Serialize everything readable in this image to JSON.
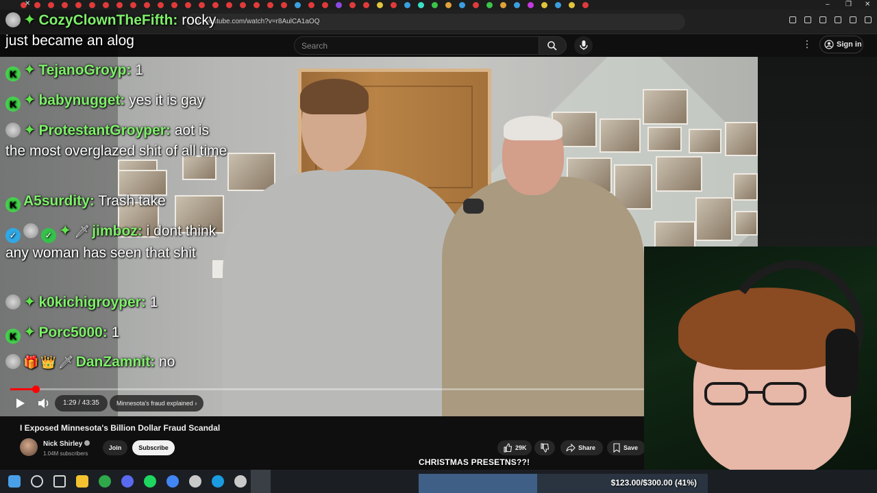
{
  "browser": {
    "url": "youtube.com/watch?v=r8AulCA1aOQ",
    "tab_colors": [
      "#e03a3a",
      "#e03a3a",
      "#e03a3a",
      "#e03a3a",
      "#e03a3a",
      "#e03a3a",
      "#e03a3a",
      "#e03a3a",
      "#e03a3a",
      "#e03a3a",
      "#e03a3a",
      "#e03a3a",
      "#e03a3a",
      "#e03a3a",
      "#e03a3a",
      "#e03a3a",
      "#e03a3a",
      "#e03a3a",
      "#e03a3a",
      "#e03a3a",
      "#3aa0e0",
      "#e03a3a",
      "#e03a3a",
      "#8a4ae0",
      "#e03a3a",
      "#e03a3a",
      "#e0c43a",
      "#e03a3a",
      "#3a9ee0",
      "#3ae0c4",
      "#3ac44a",
      "#e0a03a",
      "#3a9ee0",
      "#e03a3a",
      "#3ac44a",
      "#e0a03a",
      "#3a9ee0",
      "#c43ae0",
      "#e0c43a",
      "#3a9ee0",
      "#e0c43a",
      "#e03a3a"
    ]
  },
  "youtube": {
    "search_placeholder": "Search",
    "signin_label": "Sign in"
  },
  "chat": [
    {
      "badges": [
        "avatar",
        "star"
      ],
      "name": "CozyClownTheFifth:",
      "text": "rocky just became an alog",
      "wrap": true
    },
    {
      "badges": [
        "k",
        "star"
      ],
      "name": "TejanoGroyp:",
      "text": "1"
    },
    {
      "badges": [
        "k",
        "star"
      ],
      "name": "babynugget:",
      "text": "yes it is gay"
    },
    {
      "badges": [
        "avatar",
        "star"
      ],
      "name": "ProtestantGroyper:",
      "text": "aot is the most overglazed shit of all time",
      "wrap": true
    },
    {
      "badges": [
        "k"
      ],
      "name": "A5surdity:",
      "text": "Trash take"
    },
    {
      "badges": [
        "check",
        "avatar",
        "gcheck",
        "star",
        "sword"
      ],
      "name": "jimboz:",
      "text": "i dont think any woman has seen that shit",
      "wrap": true
    },
    {
      "badges": [
        "avatar",
        "star"
      ],
      "name": "k0kichigroyper:",
      "text": "1"
    },
    {
      "badges": [
        "k",
        "star"
      ],
      "name": "Porc5000:",
      "text": "1"
    },
    {
      "badges": [
        "avatar",
        "gift",
        "crown",
        "sword"
      ],
      "name": "DanZamnit:",
      "text": "no"
    }
  ],
  "player": {
    "progress": 0.034,
    "time": "1:29 / 43:35",
    "chapter": "Minnesota's fraud explained"
  },
  "video": {
    "title": "I Exposed Minnesota's Billion Dollar Fraud Scandal",
    "channel": "Nick Shirley",
    "subscribers": "1.04M subscribers",
    "join_label": "Join",
    "subscribe_label": "Subscribe",
    "likes": "29K",
    "share_label": "Share",
    "save_label": "Save"
  },
  "stream_overlay": {
    "banner": "CHRISTMAS PRESETNS??!",
    "goal_text": "$123.00/$300.00 (41%)",
    "goal_fraction": 0.41
  },
  "taskbar": {
    "icon_colors": [
      "#4aa0e8",
      "#d8d8d8",
      "#d8d8d8",
      "#f2c230",
      "#2fa84a",
      "#5a6af0",
      "#1ed760",
      "#4285f4",
      "#c9c9c9",
      "#1b9be0",
      "#c9c9c9",
      "#ff5a2e"
    ]
  }
}
